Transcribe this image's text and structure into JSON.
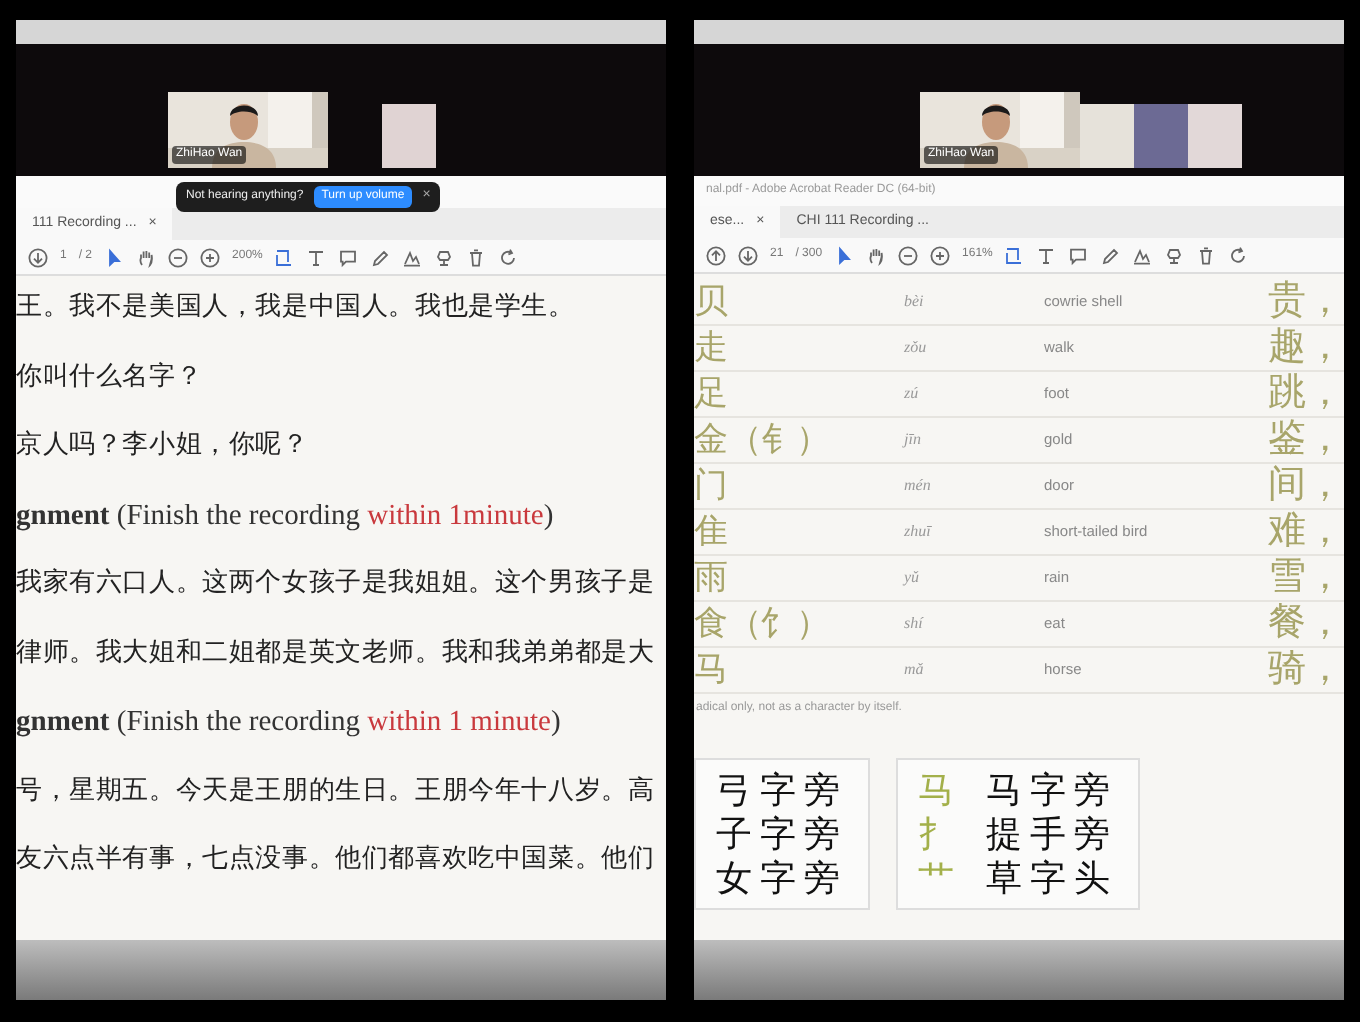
{
  "left_screen": {
    "call": {
      "participant": "ZhiHao Wan",
      "tiles": [
        {
          "color": "#e0d3d3"
        }
      ]
    },
    "notification": {
      "text": "Not hearing anything?",
      "button": "Turn up volume",
      "close": "×"
    },
    "tabs": [
      {
        "label": "111 Recording ...",
        "close": "×",
        "selected": true
      }
    ],
    "toolbar": {
      "page": "1",
      "pages": "/ 2",
      "zoom": "200%"
    },
    "lines": [
      {
        "kind": "cjk",
        "text": "王。我不是美国人，我是中国人。我也是学生。"
      },
      {
        "kind": "cjk",
        "text": "你叫什么名字？"
      },
      {
        "kind": "cjk",
        "text": "京人吗？李小姐，你呢？"
      },
      {
        "kind": "heading",
        "bold": "gnment",
        "text": " (Finish the recording ",
        "highlight": "within 1minute",
        "end": ")"
      },
      {
        "kind": "cjk",
        "text": "我家有六口人。这两个女孩子是我姐姐。这个男孩子是"
      },
      {
        "kind": "cjk",
        "text": "律师。我大姐和二姐都是英文老师。我和我弟弟都是大"
      },
      {
        "kind": "heading",
        "bold": "gnment",
        "text": " (Finish the recording ",
        "highlight": "within 1 minute",
        "end": ")"
      },
      {
        "kind": "cjk",
        "text": "号，星期五。今天是王朋的生日。王朋今年十八岁。高"
      },
      {
        "kind": "cjk",
        "text": "友六点半有事，七点没事。他们都喜欢吃中国菜。他们"
      }
    ]
  },
  "right_screen": {
    "call": {
      "participant": "ZhiHao Wan",
      "tiles": [
        {
          "color": "#e6e2da"
        },
        {
          "color": "#6c6a94"
        },
        {
          "color": "#e2d8d8"
        }
      ]
    },
    "title": "nal.pdf - Adobe Acrobat Reader DC (64-bit)",
    "tabs": [
      {
        "label": "ese...",
        "close": "×",
        "selected": true
      },
      {
        "label": "CHI 111 Recording ...",
        "selected": false
      }
    ],
    "toolbar": {
      "page": "21",
      "pages": "/ 300",
      "zoom": "161%"
    },
    "table": {
      "rows": [
        {
          "radical": "贝",
          "pinyin": "bèi",
          "meaning": "cowrie shell",
          "example": "贵，"
        },
        {
          "radical": "走",
          "pinyin": "zǒu",
          "meaning": "walk",
          "example": "趣，"
        },
        {
          "radical": "足",
          "pinyin": "zú",
          "meaning": "foot",
          "example": "跳，"
        },
        {
          "radical": "金（钅）",
          "pinyin": "jīn",
          "meaning": "gold",
          "example": "鉴，"
        },
        {
          "radical": "门",
          "pinyin": "mén",
          "meaning": "door",
          "example": "间，"
        },
        {
          "radical": "隹",
          "pinyin": "zhuī",
          "meaning": "short-tailed bird",
          "example": "难，"
        },
        {
          "radical": "雨",
          "pinyin": "yǔ",
          "meaning": "rain",
          "example": "雪，"
        },
        {
          "radical": "食（饣）",
          "pinyin": "shí",
          "meaning": "eat",
          "example": "餐，"
        },
        {
          "radical": "马",
          "pinyin": "mǎ",
          "meaning": "horse",
          "example": "骑，"
        }
      ]
    },
    "note": "adical only, not as a character by itself.",
    "cards": [
      {
        "rows": [
          {
            "chars": "弓字旁"
          },
          {
            "chars": "子字旁"
          },
          {
            "chars": "女字旁"
          }
        ]
      },
      {
        "rows": [
          {
            "radical": "马",
            "chars": "马字旁"
          },
          {
            "radical": "扌",
            "chars": "提手旁"
          },
          {
            "radical": "艹",
            "chars": "草字头"
          }
        ]
      }
    ]
  }
}
